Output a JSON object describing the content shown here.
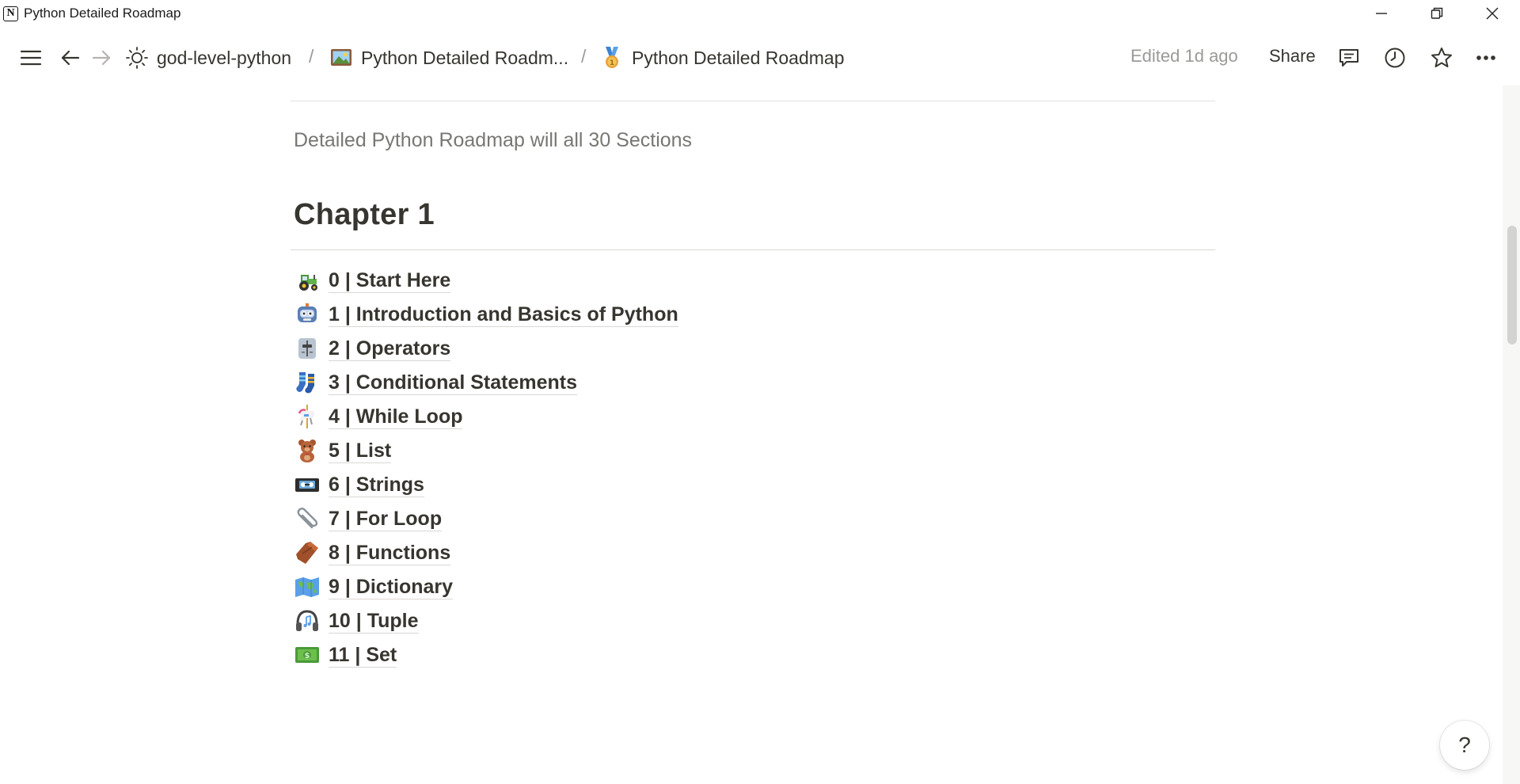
{
  "window": {
    "title": "Python Detailed Roadmap",
    "app_icon": "notion-logo"
  },
  "navbar": {
    "breadcrumbs": [
      {
        "icon": "sun-icon",
        "label": "god-level-python"
      },
      {
        "icon": "picture-icon",
        "label": "Python Detailed Roadm..."
      },
      {
        "icon": "medal-icon",
        "label": "Python Detailed Roadmap"
      }
    ],
    "separator": "/",
    "edited": "Edited 1d ago",
    "share": "Share"
  },
  "page": {
    "description": "Detailed Python Roadmap will all 30 Sections",
    "chapter_heading": "Chapter 1",
    "links": [
      {
        "icon": "tractor-icon",
        "label": "0 | Start Here"
      },
      {
        "icon": "robot-icon",
        "label": "1 | Introduction and Basics of Python"
      },
      {
        "icon": "level-slider-icon",
        "label": "2 | Operators"
      },
      {
        "icon": "socks-icon",
        "label": "3 | Conditional Statements"
      },
      {
        "icon": "carousel-horse-icon",
        "label": "4 | While Loop"
      },
      {
        "icon": "teddy-bear-icon",
        "label": "5 | List"
      },
      {
        "icon": "videocassette-icon",
        "label": "6 | Strings"
      },
      {
        "icon": "paperclip-icon",
        "label": "7 | For Loop"
      },
      {
        "icon": "coffin-icon",
        "label": "8 | Functions"
      },
      {
        "icon": "world-map-icon",
        "label": "9 | Dictionary"
      },
      {
        "icon": "headphones-icon",
        "label": "10 | Tuple"
      },
      {
        "icon": "dollar-banknote-icon",
        "label": "11 | Set"
      }
    ]
  },
  "help": {
    "label": "?"
  },
  "colors": {
    "text": "#37352f",
    "muted": "#787774",
    "divider": "#e3e2e0"
  }
}
